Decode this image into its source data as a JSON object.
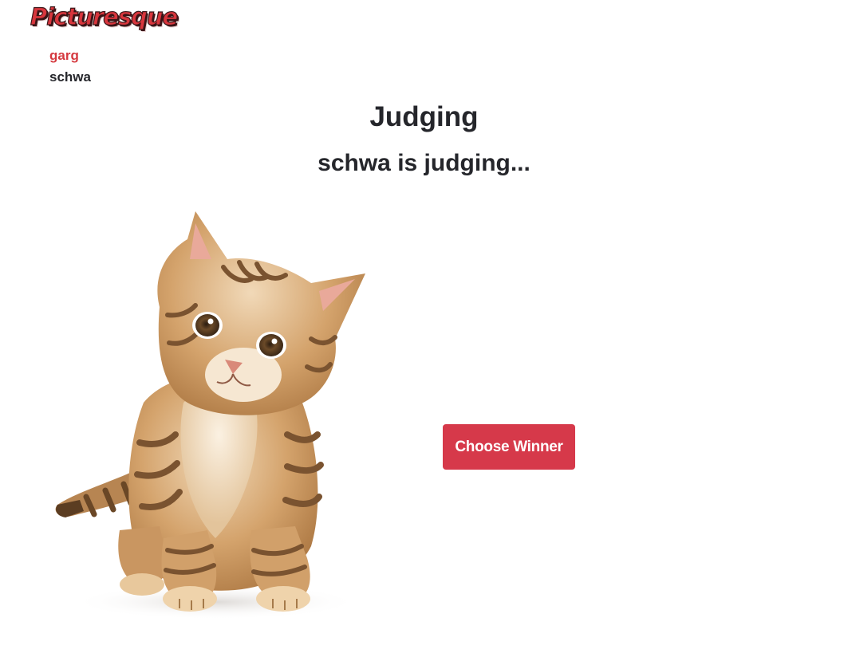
{
  "app": {
    "logo_text": "Picturesque",
    "brand_color": "#d8363d"
  },
  "players": [
    {
      "name": "garg",
      "color": "#d5393f"
    },
    {
      "name": "schwa",
      "color": "#25262b"
    }
  ],
  "main": {
    "title": "Judging",
    "status": "schwa is judging..."
  },
  "submission": {
    "image_subject": "kitten-photo"
  },
  "actions": {
    "choose_winner_label": "Choose Winner",
    "button_color": "#d6394a"
  }
}
